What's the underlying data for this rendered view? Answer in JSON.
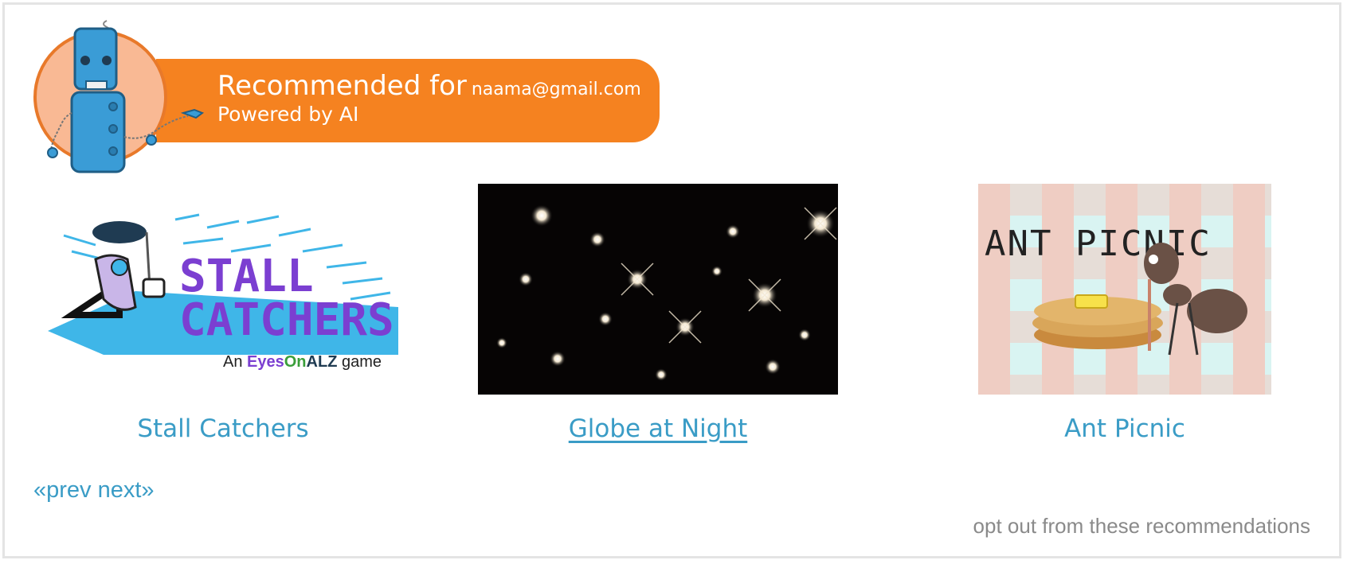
{
  "banner": {
    "title": "Recommended for",
    "email": "naama@gmail.com",
    "subtitle": "Powered by AI"
  },
  "cards": [
    {
      "caption": "Stall Catchers",
      "image_text": "STALL CATCHERS",
      "tagline_prefix": "An",
      "tagline_eyes": "Eyes",
      "tagline_on": "On",
      "tagline_alz": "ALZ",
      "tagline_suffix": "game"
    },
    {
      "caption": "Globe at Night"
    },
    {
      "caption": "Ant Picnic",
      "image_text": "ANT PICNIC"
    }
  ],
  "pager": {
    "prev": "«prev",
    "next": "next»"
  },
  "optout": "opt out from these recommendations",
  "colors": {
    "accent": "#f58220",
    "link": "#3a9cc6",
    "muted": "#8a8a8a",
    "stall_purple": "#7b3fd1",
    "stall_blue": "#3fb6e8"
  }
}
